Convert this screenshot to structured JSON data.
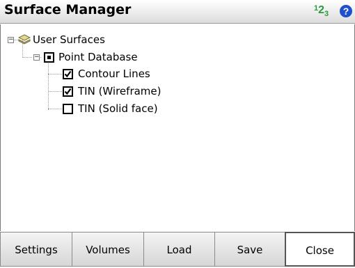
{
  "window": {
    "title": "Surface Manager",
    "num_icon": {
      "a": "1",
      "b": "2",
      "c": "3"
    },
    "help_glyph": "?"
  },
  "tree": {
    "root": {
      "label": "User Surfaces",
      "icon": "layers-icon"
    },
    "database": {
      "label": "Point Database",
      "state": "partial"
    },
    "layers": [
      {
        "label": "Contour Lines",
        "checked": true
      },
      {
        "label": "TIN (Wireframe)",
        "checked": true
      },
      {
        "label": "TIN (Solid face)",
        "checked": false
      }
    ]
  },
  "buttons": {
    "settings": "Settings",
    "volumes": "Volumes",
    "load": "Load",
    "save": "Save",
    "close": "Close"
  },
  "colors": {
    "accent_green": "#2a9a3a",
    "help_blue": "#1f4fcc"
  }
}
